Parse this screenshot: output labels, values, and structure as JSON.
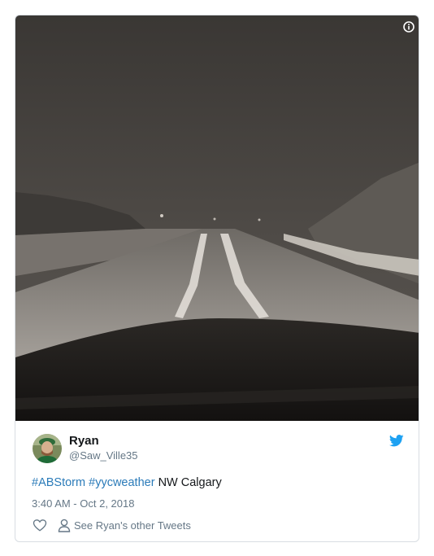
{
  "tweet": {
    "media": {
      "info_icon": "info-icon"
    },
    "author": {
      "name": "Ryan",
      "handle": "@Saw_Ville35",
      "avatar_icon": "avatar"
    },
    "brand_icon": "twitter-bird-icon",
    "brand_color": "#1da1f2",
    "hashtags": [
      "#ABStorm",
      "#yycweather"
    ],
    "text_suffix": "NW Calgary",
    "link_color": "#2b7bb9",
    "timestamp": "3:40 AM - Oct 2, 2018",
    "actions": {
      "like_icon": "heart-icon",
      "profile_icon": "person-icon",
      "other_tweets_label": "See Ryan's other Tweets"
    }
  }
}
